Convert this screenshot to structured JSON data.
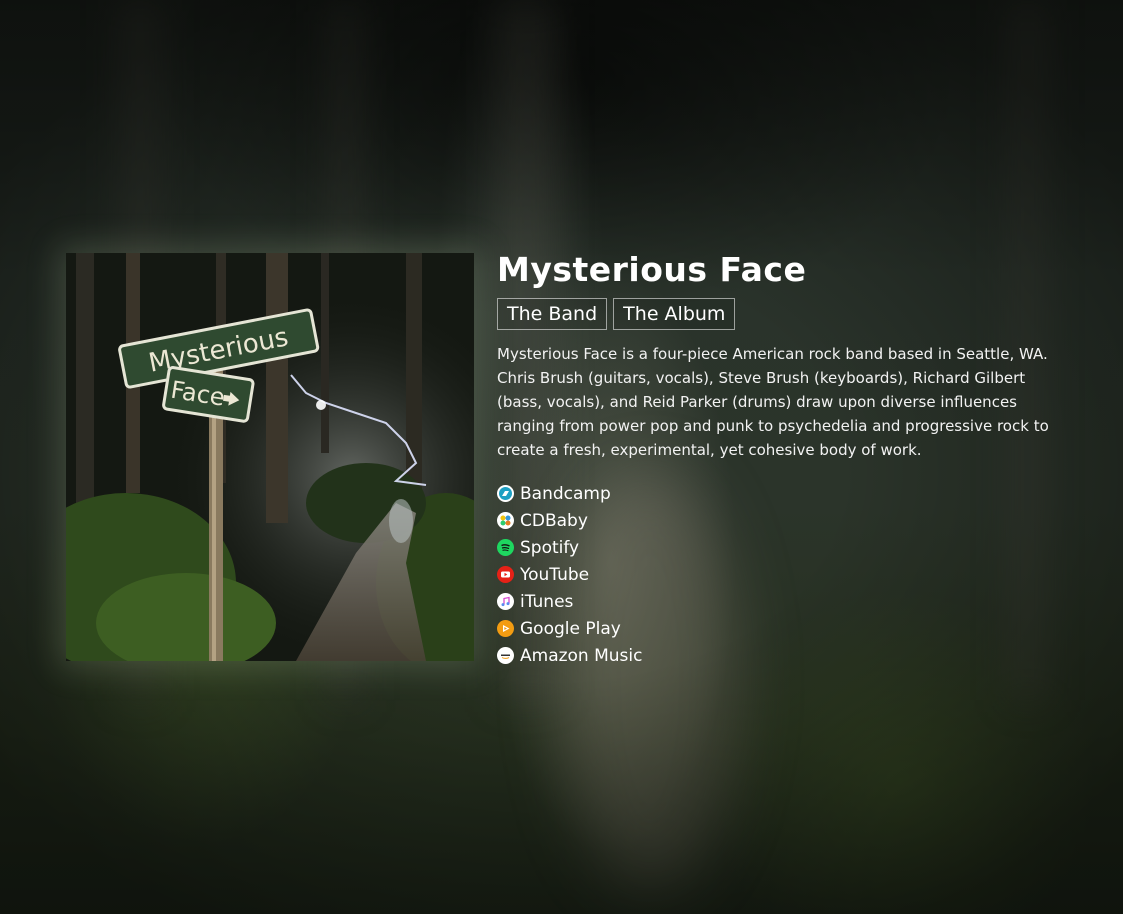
{
  "band": {
    "title": "Mysterious Face",
    "tabs": [
      {
        "label": "The Band"
      },
      {
        "label": "The Album"
      }
    ],
    "description": "Mysterious Face is a four-piece American rock band based in Seattle, WA. Chris Brush (guitars, vocals), Steve Brush (keyboards), Richard Gilbert (bass, vocals), and Reid Parker (drums) draw upon diverse influences ranging from power pop and punk to psychedelia and progressive rock to create a fresh, experimental, yet cohesive body of work."
  },
  "album_cover": {
    "sign_top": "Mysterious",
    "sign_bottom": "Face"
  },
  "links": [
    {
      "label": "Bandcamp",
      "icon": "bandcamp-icon",
      "color": "#1da0c3"
    },
    {
      "label": "CDBaby",
      "icon": "cdbaby-icon",
      "color": "#ffffff"
    },
    {
      "label": "Spotify",
      "icon": "spotify-icon",
      "color": "#1ed760"
    },
    {
      "label": "YouTube",
      "icon": "youtube-icon",
      "color": "#e62117"
    },
    {
      "label": "iTunes",
      "icon": "itunes-icon",
      "color": "#ffffff"
    },
    {
      "label": "Google Play",
      "icon": "google-play-icon",
      "color": "#f39c12"
    },
    {
      "label": "Amazon Music",
      "icon": "amazon-music-icon",
      "color": "#ffffff"
    }
  ]
}
